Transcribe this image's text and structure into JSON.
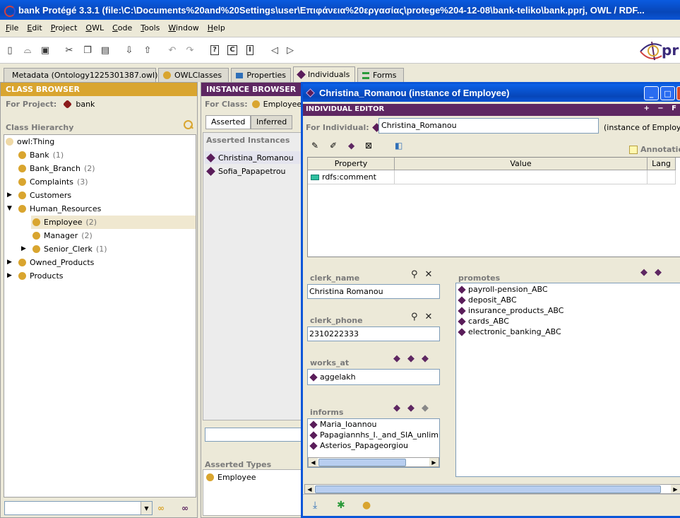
{
  "window": {
    "title": "bank  Protégé 3.3.1     (file:\\C:\\Documents%20and%20Settings\\user\\Επιφάνεια%20εργασίας\\protege%204-12-08\\bank-teliko\\bank.pprj, OWL / RDF..."
  },
  "menu": [
    {
      "u": "F",
      "rest": "ile"
    },
    {
      "u": "E",
      "rest": "dit"
    },
    {
      "u": "P",
      "rest": "roject"
    },
    {
      "u": "O",
      "rest": "WL"
    },
    {
      "u": "C",
      "rest": "ode"
    },
    {
      "u": "T",
      "rest": "ools"
    },
    {
      "u": "W",
      "rest": "indow"
    },
    {
      "u": "H",
      "rest": "elp"
    }
  ],
  "toolbar": {
    "icons": [
      "new-file-icon",
      "open-folder-icon",
      "save-icon",
      "cut-icon",
      "copy-icon",
      "paste-icon",
      "import-icon",
      "export-icon",
      "undo-icon",
      "redo-icon",
      "query-icon",
      "class-icon",
      "instance-icon",
      "back-icon",
      "forward-icon"
    ],
    "box_labels": {
      "query": "?",
      "cls": "C",
      "inst": "I"
    },
    "logo_text": "pr"
  },
  "tabs": [
    {
      "label": "Metadata (Ontology1225301387.owl)",
      "icon": "metadata-icon"
    },
    {
      "label": "OWLClasses",
      "icon": "owlclasses-icon"
    },
    {
      "label": "Properties",
      "icon": "properties-icon"
    },
    {
      "label": "Individuals",
      "icon": "individuals-icon"
    },
    {
      "label": "Forms",
      "icon": "forms-icon"
    }
  ],
  "class_browser": {
    "header": "CLASS BROWSER",
    "for_project_label": "For Project:",
    "project": "bank",
    "hierarchy_label": "Class Hierarchy",
    "tree": [
      {
        "name": "owl:Thing",
        "count": "",
        "toggle": ""
      },
      {
        "name": "Bank",
        "count": "(1)",
        "toggle": ""
      },
      {
        "name": "Bank_Branch",
        "count": "(2)",
        "toggle": ""
      },
      {
        "name": "Complaints",
        "count": "(3)",
        "toggle": ""
      },
      {
        "name": "Customers",
        "count": "",
        "toggle": "▶"
      },
      {
        "name": "Human_Resources",
        "count": "",
        "toggle": "▼"
      },
      {
        "name": "Employee",
        "count": "(2)",
        "toggle": ""
      },
      {
        "name": "Manager",
        "count": "(2)",
        "toggle": ""
      },
      {
        "name": "Senior_Clerk",
        "count": "(1)",
        "toggle": "▶"
      },
      {
        "name": "Owned_Products",
        "count": "",
        "toggle": "▶"
      },
      {
        "name": "Products",
        "count": "",
        "toggle": "▶"
      }
    ]
  },
  "instance_browser": {
    "header": "INSTANCE BROWSER",
    "for_class_label": "For Class:",
    "class": "Employee",
    "tab_asserted": "Asserted",
    "tab_inferred": "Inferred",
    "asserted_label": "Asserted Instances",
    "instances": [
      "Christina_Romanou",
      "Sofia_Papapetrou"
    ],
    "types_label": "Asserted Types",
    "types": [
      "Employee"
    ]
  },
  "editor": {
    "title": "Christina_Romanou   (instance of Employee)",
    "header": "INDIVIDUAL EDITOR",
    "header_controls": "+ − F",
    "for_individual_label": "For Individual:",
    "individual": "Christina_Romanou",
    "instance_of": "(instance of Employee",
    "annotations_label": "Annotation",
    "columns": {
      "property": "Property",
      "value": "Value",
      "lang": "Lang"
    },
    "rows": [
      {
        "property": "rdfs:comment",
        "value": "",
        "lang": ""
      }
    ],
    "clerk_name_label": "clerk_name",
    "clerk_name": "Christina Romanou",
    "clerk_phone_label": "clerk_phone",
    "clerk_phone": "2310222333",
    "works_at_label": "works_at",
    "works_at": [
      "aggelakh"
    ],
    "informs_label": "informs",
    "informs": [
      "Maria_Ioannou",
      "Papagiannhs_I._and_SIA_unlimited_",
      "Asterios_Papageorgiou"
    ],
    "promotes_label": "promotes",
    "promotes": [
      "payroll-pension_ABC",
      "deposit_ABC",
      "insurance_products_ABC",
      "cards_ABC",
      "electronic_banking_ABC"
    ]
  },
  "colors": {
    "accent_gold": "#d9a52f",
    "accent_purple": "#5e2762",
    "titlebar_blue": "#0a56d8"
  }
}
